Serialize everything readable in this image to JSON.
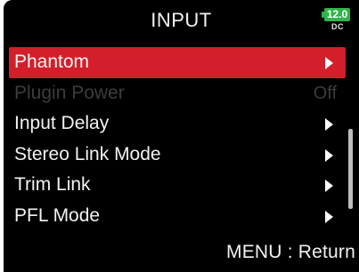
{
  "header": {
    "title": "INPUT",
    "battery_level": "12.0",
    "power_source": "DC",
    "battery_color": "#2fb44b"
  },
  "menu": {
    "items": [
      {
        "label": "Phantom",
        "state": "selected"
      },
      {
        "label": "Plugin Power",
        "value": "Off",
        "state": "disabled"
      },
      {
        "label": "Input Delay"
      },
      {
        "label": "Stereo Link Mode"
      },
      {
        "label": "Trim Link"
      },
      {
        "label": "PFL Mode"
      }
    ],
    "selected_color": "#d21f2b"
  },
  "footer": {
    "hint": "MENU : Return"
  }
}
